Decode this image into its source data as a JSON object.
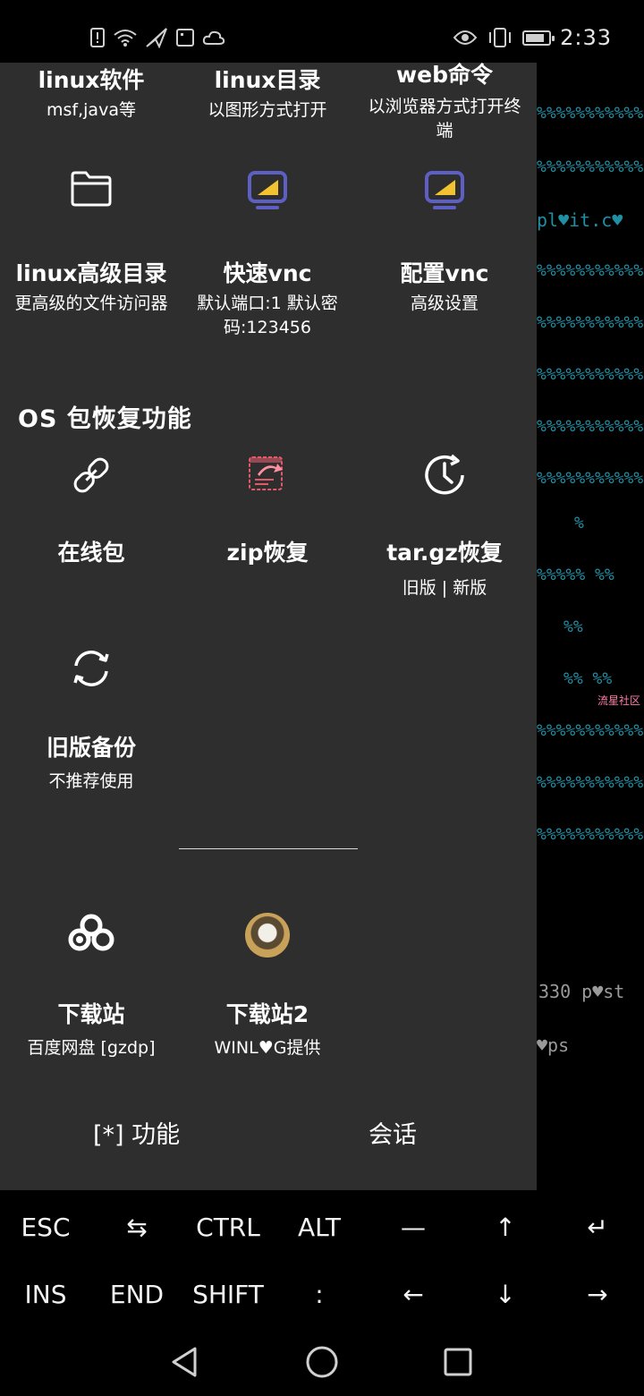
{
  "status_bar": {
    "time": "2:33",
    "battery_level": 0.85,
    "left_icons": [
      "alert-icon",
      "wifi-icon",
      "paper-plane-icon",
      "sim-icon",
      "cloud-icon"
    ],
    "right_icons": [
      "eye-icon",
      "vibrate-icon",
      "battery-icon"
    ]
  },
  "terminal_background": {
    "lines": [
      "%%%%%%%%%%%",
      "%%%%%%%%%%%",
      "pl♥it.c♥",
      "%%%%%%%%%%%",
      "%%%%%%%%%%%",
      "%%%%%%%%%%%",
      "%%%%%%%%%%%",
      "%%%%%%%%%%%",
      "%",
      "%%%%%   %%",
      "%%",
      "%%   %%",
      "流星社区",
      "%%%%%%%%%%%",
      "%%%%%%%%%%%",
      "%%%%%%%%%%%",
      "330 p♥st",
      "♥ps"
    ]
  },
  "drawer": {
    "top_row": [
      {
        "title": "linux软件",
        "sub": "msf,java等"
      },
      {
        "title": "linux目录",
        "sub": "以图形方式打开"
      },
      {
        "title": "web命令",
        "sub": "以浏览器方式打开终端"
      }
    ],
    "row2": [
      {
        "title": "linux高级目录",
        "sub": "更高级的文件访问器",
        "icon": "folder-icon"
      },
      {
        "title": "快速vnc",
        "sub": "默认端口:1 默认密码:123456",
        "icon": "monitor-icon"
      },
      {
        "title": "配置vnc",
        "sub": "高级设置",
        "icon": "monitor-icon"
      }
    ],
    "section_title": "OS 包恢复功能",
    "row3": [
      {
        "title": "在线包",
        "sub": "",
        "icon": "link-icon"
      },
      {
        "title": "zip恢复",
        "sub": "",
        "icon": "archive-restore-icon"
      },
      {
        "title": "tar.gz恢复",
        "sub": "旧版 | 新版",
        "icon": "clock-restore-icon"
      }
    ],
    "row4": [
      {
        "title": "旧版备份",
        "sub": "不推荐使用",
        "icon": "sync-icon"
      }
    ],
    "row5": [
      {
        "title": "下载站",
        "sub": "百度网盘 [gzdp]",
        "icon": "baidu-cloud-icon"
      },
      {
        "title": "下载站2",
        "sub": "WINL♥G提供",
        "icon": "dog-avatar"
      }
    ],
    "footer": {
      "functions_label": "[*] 功能",
      "session_label": "会话"
    }
  },
  "extra_keys": {
    "row1": [
      "ESC",
      "⇆",
      "CTRL",
      "ALT",
      "—",
      "↑",
      "↵"
    ],
    "row2": [
      "INS",
      "END",
      "SHIFT",
      ":",
      "←",
      "↓",
      "→"
    ]
  },
  "nav_bar": {
    "icons": [
      "back-icon",
      "home-icon",
      "recents-icon"
    ]
  },
  "colors": {
    "drawer_bg": "#2e2e2e",
    "terminal_text": "#1f8fa3",
    "monitor_accent": "#f2c230",
    "monitor_frame": "#5d5fc4",
    "archive_accent": "#e05a6a"
  }
}
